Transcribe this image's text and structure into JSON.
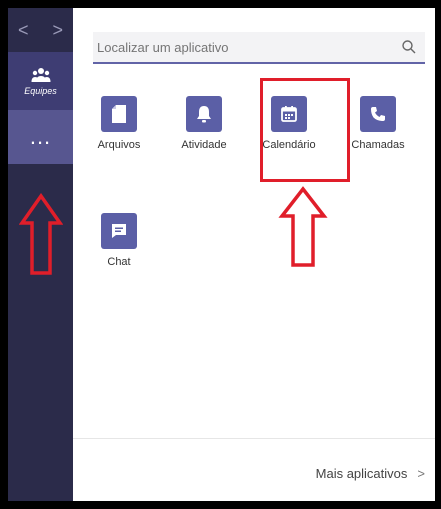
{
  "rail": {
    "back": "<",
    "forward": ">",
    "teams_label": "Equipes",
    "more_label": "..."
  },
  "search": {
    "placeholder": "Localizar um aplicativo"
  },
  "apps": [
    {
      "label": "Arquivos",
      "icon": "file-icon"
    },
    {
      "label": "Atividade",
      "icon": "bell-icon"
    },
    {
      "label": "Calendário",
      "icon": "calendar-icon"
    },
    {
      "label": "Chamadas",
      "icon": "phone-icon"
    },
    {
      "label": "Chat",
      "icon": "chat-icon"
    }
  ],
  "footer": {
    "more_apps": "Mais aplicativos",
    "chevron": ">"
  },
  "colors": {
    "rail_bg": "#2b2b4a",
    "tile": "#5b5fa6",
    "annotation_red": "#e01e2a"
  }
}
